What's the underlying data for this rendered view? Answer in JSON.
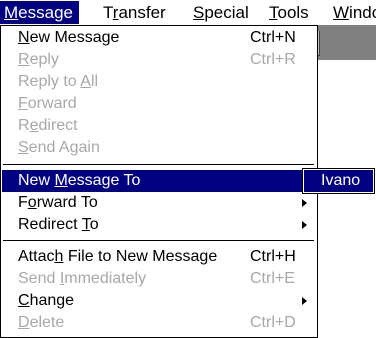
{
  "menubar": [
    {
      "pre": "",
      "mn": "M",
      "post": "essage"
    },
    {
      "pre": "T",
      "mn": "r",
      "post": "ansfer"
    },
    {
      "pre": "",
      "mn": "S",
      "post": "pecial"
    },
    {
      "pre": "",
      "mn": "T",
      "post": "ools"
    },
    {
      "pre": "",
      "mn": "W",
      "post": "indo"
    }
  ],
  "toolbar": {
    "help_glyph": "?"
  },
  "message_menu": {
    "items": [
      {
        "pre": "",
        "mn": "N",
        "post": "ew Message",
        "shortcut": "Ctrl+N",
        "state": "enabled"
      },
      {
        "pre": "",
        "mn": "R",
        "post": "eply",
        "shortcut": "Ctrl+R",
        "state": "disabled"
      },
      {
        "pre": "Reply to ",
        "mn": "A",
        "post": "ll",
        "shortcut": "",
        "state": "disabled"
      },
      {
        "pre": "",
        "mn": "F",
        "post": "orward",
        "shortcut": "",
        "state": "disabled"
      },
      {
        "pre": "R",
        "mn": "e",
        "post": "direct",
        "shortcut": "",
        "state": "disabled"
      },
      {
        "pre": "",
        "mn": "S",
        "post": "end Again",
        "shortcut": "",
        "state": "disabled"
      },
      {
        "pre": "New ",
        "mn": "M",
        "post": "essage To",
        "shortcut": "",
        "state": "highlighted",
        "submenu": true
      },
      {
        "pre": "F",
        "mn": "o",
        "post": "rward To",
        "shortcut": "",
        "state": "enabled",
        "submenu": true
      },
      {
        "pre": "Redirect ",
        "mn": "T",
        "post": "o",
        "shortcut": "",
        "state": "enabled",
        "submenu": true
      },
      {
        "pre": "Attac",
        "mn": "h",
        "post": " File to New Message",
        "shortcut": "Ctrl+H",
        "state": "enabled"
      },
      {
        "pre": "Send ",
        "mn": "I",
        "post": "mmediately",
        "shortcut": "Ctrl+E",
        "state": "disabled"
      },
      {
        "pre": "",
        "mn": "C",
        "post": "hange",
        "shortcut": "",
        "state": "enabled",
        "submenu": true
      },
      {
        "pre": "",
        "mn": "D",
        "post": "elete",
        "shortcut": "Ctrl+D",
        "state": "disabled"
      }
    ]
  },
  "submenu": {
    "items": [
      {
        "label": "Ivano"
      }
    ]
  }
}
